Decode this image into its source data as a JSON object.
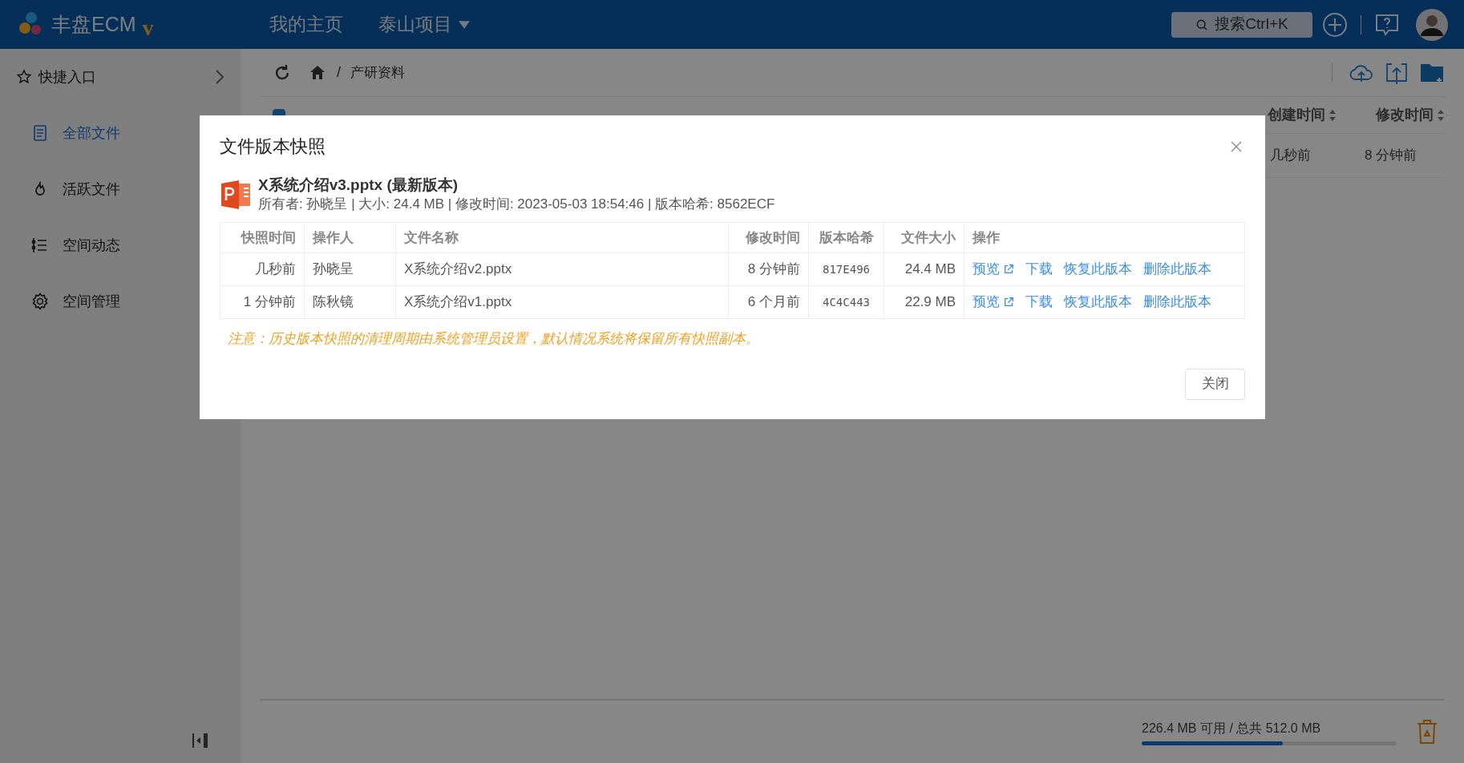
{
  "topbar": {
    "logo": "丰盘ECM",
    "logo_mark": "v",
    "nav": [
      {
        "label": "我的主页",
        "dropdown": false
      },
      {
        "label": "泰山项目",
        "dropdown": true
      }
    ],
    "search": "搜索Ctrl+K"
  },
  "sidebar": {
    "shortcut": "快捷入口",
    "items": [
      {
        "label": "全部文件",
        "selected": true
      },
      {
        "label": "活跃文件",
        "selected": false
      },
      {
        "label": "空间动态",
        "selected": false
      },
      {
        "label": "空间管理",
        "selected": false
      }
    ]
  },
  "breadcrumb": [
    {
      "separator": "/",
      "label": "产研资料"
    }
  ],
  "file_table": {
    "select_all": {
      "checked": true
    },
    "columns": [
      "创建时间",
      "修改时间"
    ],
    "row_cells": [
      "几秒前",
      "8 分钟前"
    ]
  },
  "storage": {
    "text": "226.4 MB 可用 / 总共 512.0 MB",
    "level": 0.555
  },
  "dialog": {
    "title": "文件版本快照",
    "file_name": "X系统介绍v3.pptx (最新版本)",
    "file_meta": "所有者: 孙晓呈 | 大小: 24.4 MB | 修改时间: 2023-05-03 18:54:46 | 版本哈希: 8562ECF",
    "columns": [
      "快照时间",
      "操作人",
      "文件名称",
      "修改时间",
      "版本哈希",
      "文件大小",
      "操作"
    ],
    "rows": [
      {
        "snapshot_time": "几秒前",
        "operator": "孙晓呈",
        "file_name": "X系统介绍v2.pptx",
        "modified": "8 分钟前",
        "hash": "817E496",
        "size": "24.4 MB",
        "actions": [
          "预览",
          "下载",
          "恢复此版本",
          "删除此版本"
        ]
      },
      {
        "snapshot_time": "1 分钟前",
        "operator": "陈秋镜",
        "file_name": "X系统介绍v1.pptx",
        "modified": "6 个月前",
        "hash": "4C4C443",
        "size": "22.9 MB",
        "actions": [
          "预览",
          "下载",
          "恢复此版本",
          "删除此版本"
        ]
      }
    ],
    "note": "注意：历史版本快照的清理周期由系统管理员设置，默认情况系统将保留所有快照副本。",
    "close_button": "关闭"
  }
}
